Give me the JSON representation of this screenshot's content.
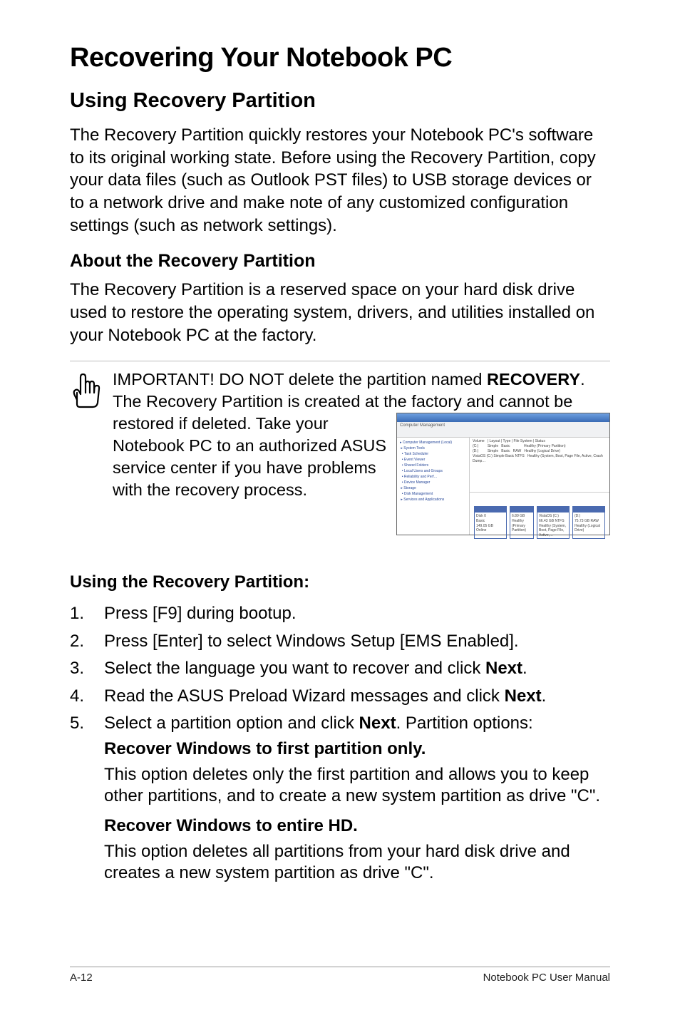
{
  "title": "Recovering Your Notebook PC",
  "section1": {
    "heading": "Using Recovery Partition",
    "p1": "The Recovery Partition quickly restores your Notebook PC's software to its original working state. Before using the Recovery Partition, copy your data files (such as Outlook PST files) to USB storage devices or to a network drive and make note of any customized configuration settings (such as network settings)."
  },
  "about": {
    "heading": "About the Recovery Partition",
    "p1": "The Recovery Partition is a reserved space on your hard disk drive used to restore the operating system, drivers, and utilities installed on your Notebook PC at the factory."
  },
  "important": {
    "line_lead": "IMPORTANT! DO NOT delete the partition named ",
    "line_bold": "RECOVERY",
    "line_tail": ". The Recovery Partition is created at the factory and cannot be ",
    "left_rest": "restored if deleted. Take your Notebook PC to an authorized ASUS service center if you have problems with the recovery process."
  },
  "thumb": {
    "title": "Computer Management"
  },
  "using": {
    "heading": "Using the Recovery Partition:"
  },
  "steps": [
    {
      "num": "1.",
      "text": "Press [F9] during bootup."
    },
    {
      "num": "2.",
      "text": "Press [Enter] to select Windows Setup [EMS Enabled]."
    },
    {
      "num": "3.",
      "text_lead": "Select the language you want to recover and click ",
      "bold": "Next",
      "text_tail": "."
    },
    {
      "num": "4.",
      "text_lead": "Read the ASUS Preload Wizard messages and click ",
      "bold": "Next",
      "text_tail": "."
    },
    {
      "num": "5.",
      "text_lead": "Select a partition option and click ",
      "bold": "Next",
      "text_tail": ". Partition options:"
    }
  ],
  "opt1": {
    "h": "Recover Windows to first partition only.",
    "p": "This option deletes only the first partition and allows you to keep other partitions, and to create a new system partition as drive \"C\"."
  },
  "opt2": {
    "h": "Recover Windows to entire HD.",
    "p": "This option deletes all partitions from your hard disk drive and creates a new system partition as drive \"C\"."
  },
  "footer": {
    "left": "A-12",
    "right": "Notebook PC User Manual"
  }
}
